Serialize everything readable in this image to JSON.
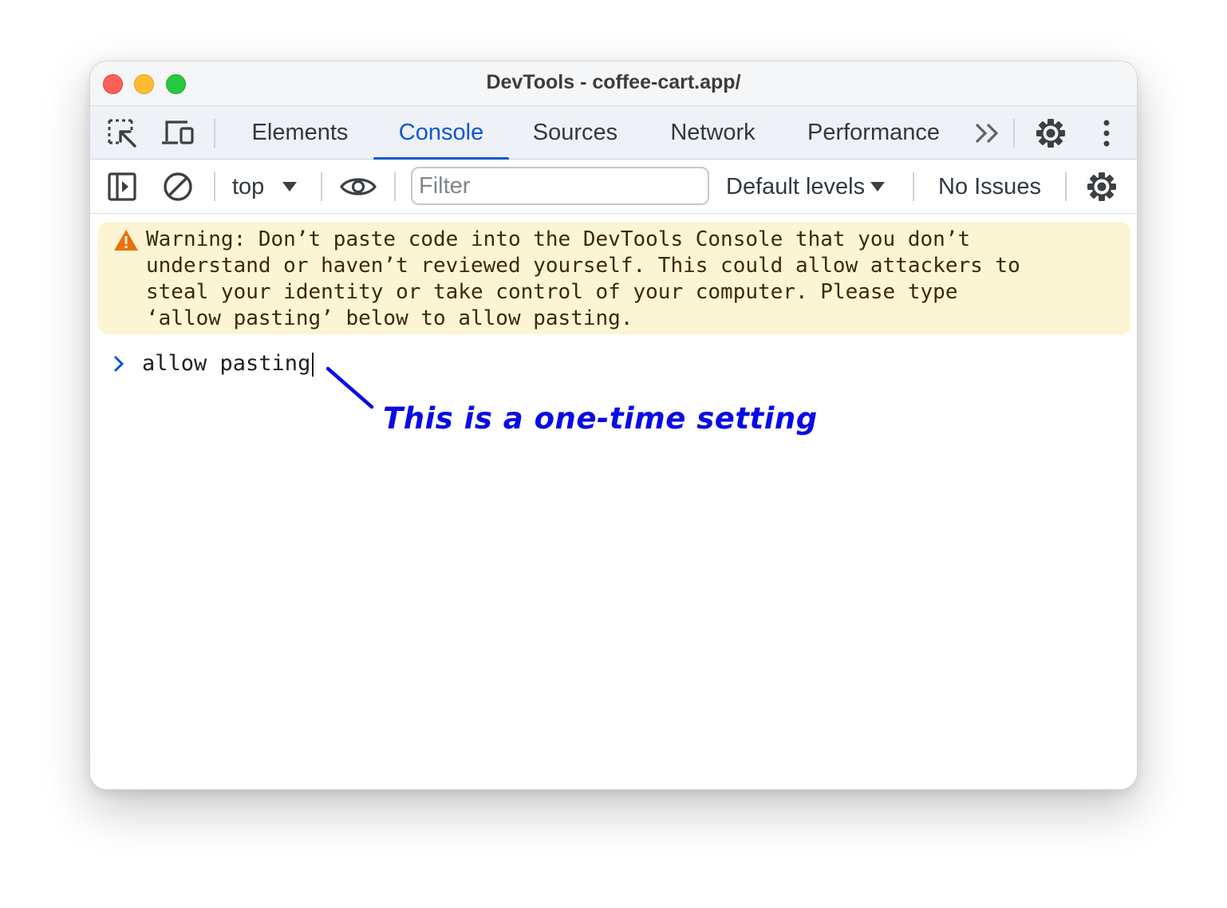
{
  "window": {
    "title": "DevTools - coffee-cart.app/"
  },
  "tabbar": {
    "left_icons": [
      "inspect-element-icon",
      "device-toolbar-icon"
    ],
    "tabs": [
      {
        "label": "Elements",
        "active": false
      },
      {
        "label": "Console",
        "active": true
      },
      {
        "label": "Sources",
        "active": false
      },
      {
        "label": "Network",
        "active": false
      },
      {
        "label": "Performance",
        "active": false
      }
    ],
    "right_icons": [
      "more-tabs-icon",
      "settings-gear-icon",
      "kebab-menu-icon"
    ]
  },
  "toolbar": {
    "context_label": "top",
    "filter_placeholder": "Filter",
    "filter_value": "",
    "levels_label": "Default levels",
    "issues_label": "No Issues"
  },
  "console": {
    "warning_text": "Warning: Don’t paste code into the DevTools Console that you don’t\nunderstand or haven’t reviewed yourself. This could allow attackers to\nsteal your identity or take control of your computer. Please type\n‘allow pasting’ below to allow pasting.",
    "input_text": "allow pasting"
  },
  "annotation": {
    "text": "This is a one-time setting"
  },
  "colors": {
    "accent": "#0b57d0",
    "warning_bg": "#fcf5d4",
    "warning_icon": "#e8710a",
    "annotation": "#0a0ae6"
  }
}
